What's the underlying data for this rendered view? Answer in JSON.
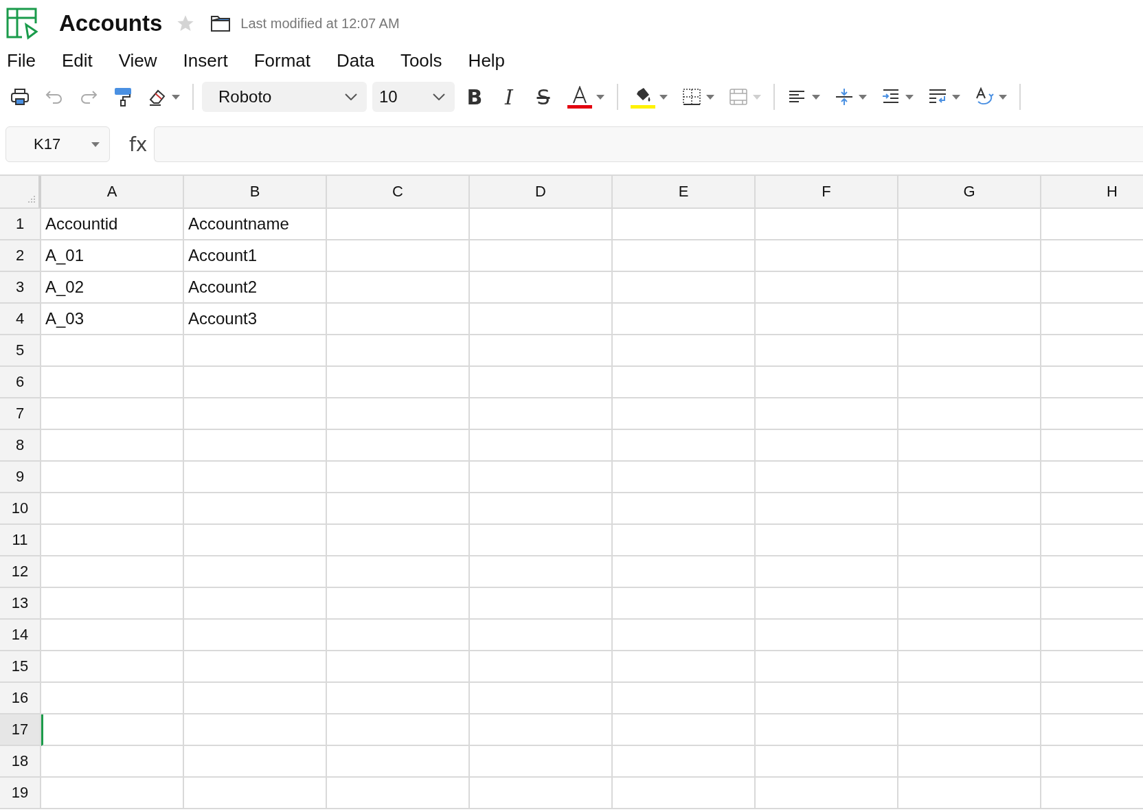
{
  "document": {
    "title": "Accounts",
    "starred": false,
    "last_modified": "Last modified at 12:07 AM"
  },
  "menu": [
    "File",
    "Edit",
    "View",
    "Insert",
    "Format",
    "Data",
    "Tools",
    "Help"
  ],
  "toolbar": [
    {
      "kind": "print",
      "disabled": false,
      "menu": false
    },
    {
      "kind": "undo",
      "disabled": true,
      "menu": false
    },
    {
      "kind": "redo",
      "disabled": true,
      "menu": false
    },
    {
      "kind": "paint-format",
      "disabled": false,
      "menu": false
    },
    {
      "kind": "clear",
      "disabled": false,
      "menu": true
    },
    {
      "kind": "separator"
    },
    {
      "kind": "select",
      "value": "Roboto",
      "wide": true
    },
    {
      "kind": "select",
      "value": "10",
      "wide": false
    },
    {
      "kind": "bold",
      "label": "B",
      "disabled": false,
      "menu": false
    },
    {
      "kind": "italic",
      "label": "I",
      "disabled": false,
      "menu": false
    },
    {
      "kind": "strike",
      "label": "S",
      "disabled": false,
      "menu": false
    },
    {
      "kind": "text-color",
      "disabled": false,
      "menu": true,
      "color": "#e3000f"
    },
    {
      "kind": "separator"
    },
    {
      "kind": "fill-color",
      "disabled": false,
      "menu": true,
      "color": "#fff200"
    },
    {
      "kind": "borders",
      "disabled": false,
      "menu": true
    },
    {
      "kind": "merge",
      "disabled": true,
      "menu": true
    },
    {
      "kind": "separator"
    },
    {
      "kind": "align",
      "disabled": false,
      "menu": true
    },
    {
      "kind": "valign",
      "disabled": false,
      "menu": true
    },
    {
      "kind": "indent",
      "disabled": false,
      "menu": true
    },
    {
      "kind": "wrap",
      "disabled": false,
      "menu": true
    },
    {
      "kind": "rotate",
      "disabled": false,
      "menu": true
    },
    {
      "kind": "separator"
    }
  ],
  "formula_bar": {
    "cell": "K17",
    "fx": "fx"
  },
  "columns": [
    "A",
    "B",
    "C",
    "D",
    "E",
    "F",
    "G",
    "H"
  ],
  "rows": [
    {
      "label": "1",
      "selected": false,
      "cells": [
        "Accountid",
        "Accountname"
      ]
    },
    {
      "label": "2",
      "selected": false,
      "cells": [
        "A_01",
        "Account1"
      ]
    },
    {
      "label": "3",
      "selected": false,
      "cells": [
        "A_02",
        "Account2"
      ]
    },
    {
      "label": "4",
      "selected": false,
      "cells": [
        "A_03",
        "Account3"
      ]
    },
    {
      "label": "5",
      "selected": false,
      "cells": []
    },
    {
      "label": "6",
      "selected": false,
      "cells": []
    },
    {
      "label": "7",
      "selected": false,
      "cells": []
    },
    {
      "label": "8",
      "selected": false,
      "cells": []
    },
    {
      "label": "9",
      "selected": false,
      "cells": []
    },
    {
      "label": "10",
      "selected": false,
      "cells": []
    },
    {
      "label": "11",
      "selected": false,
      "cells": []
    },
    {
      "label": "12",
      "selected": false,
      "cells": []
    },
    {
      "label": "13",
      "selected": false,
      "cells": []
    },
    {
      "label": "14",
      "selected": false,
      "cells": []
    },
    {
      "label": "15",
      "selected": false,
      "cells": []
    },
    {
      "label": "16",
      "selected": false,
      "cells": []
    },
    {
      "label": "17",
      "selected": true,
      "cells": []
    },
    {
      "label": "18",
      "selected": false,
      "cells": []
    },
    {
      "label": "19",
      "selected": false,
      "cells": []
    }
  ]
}
